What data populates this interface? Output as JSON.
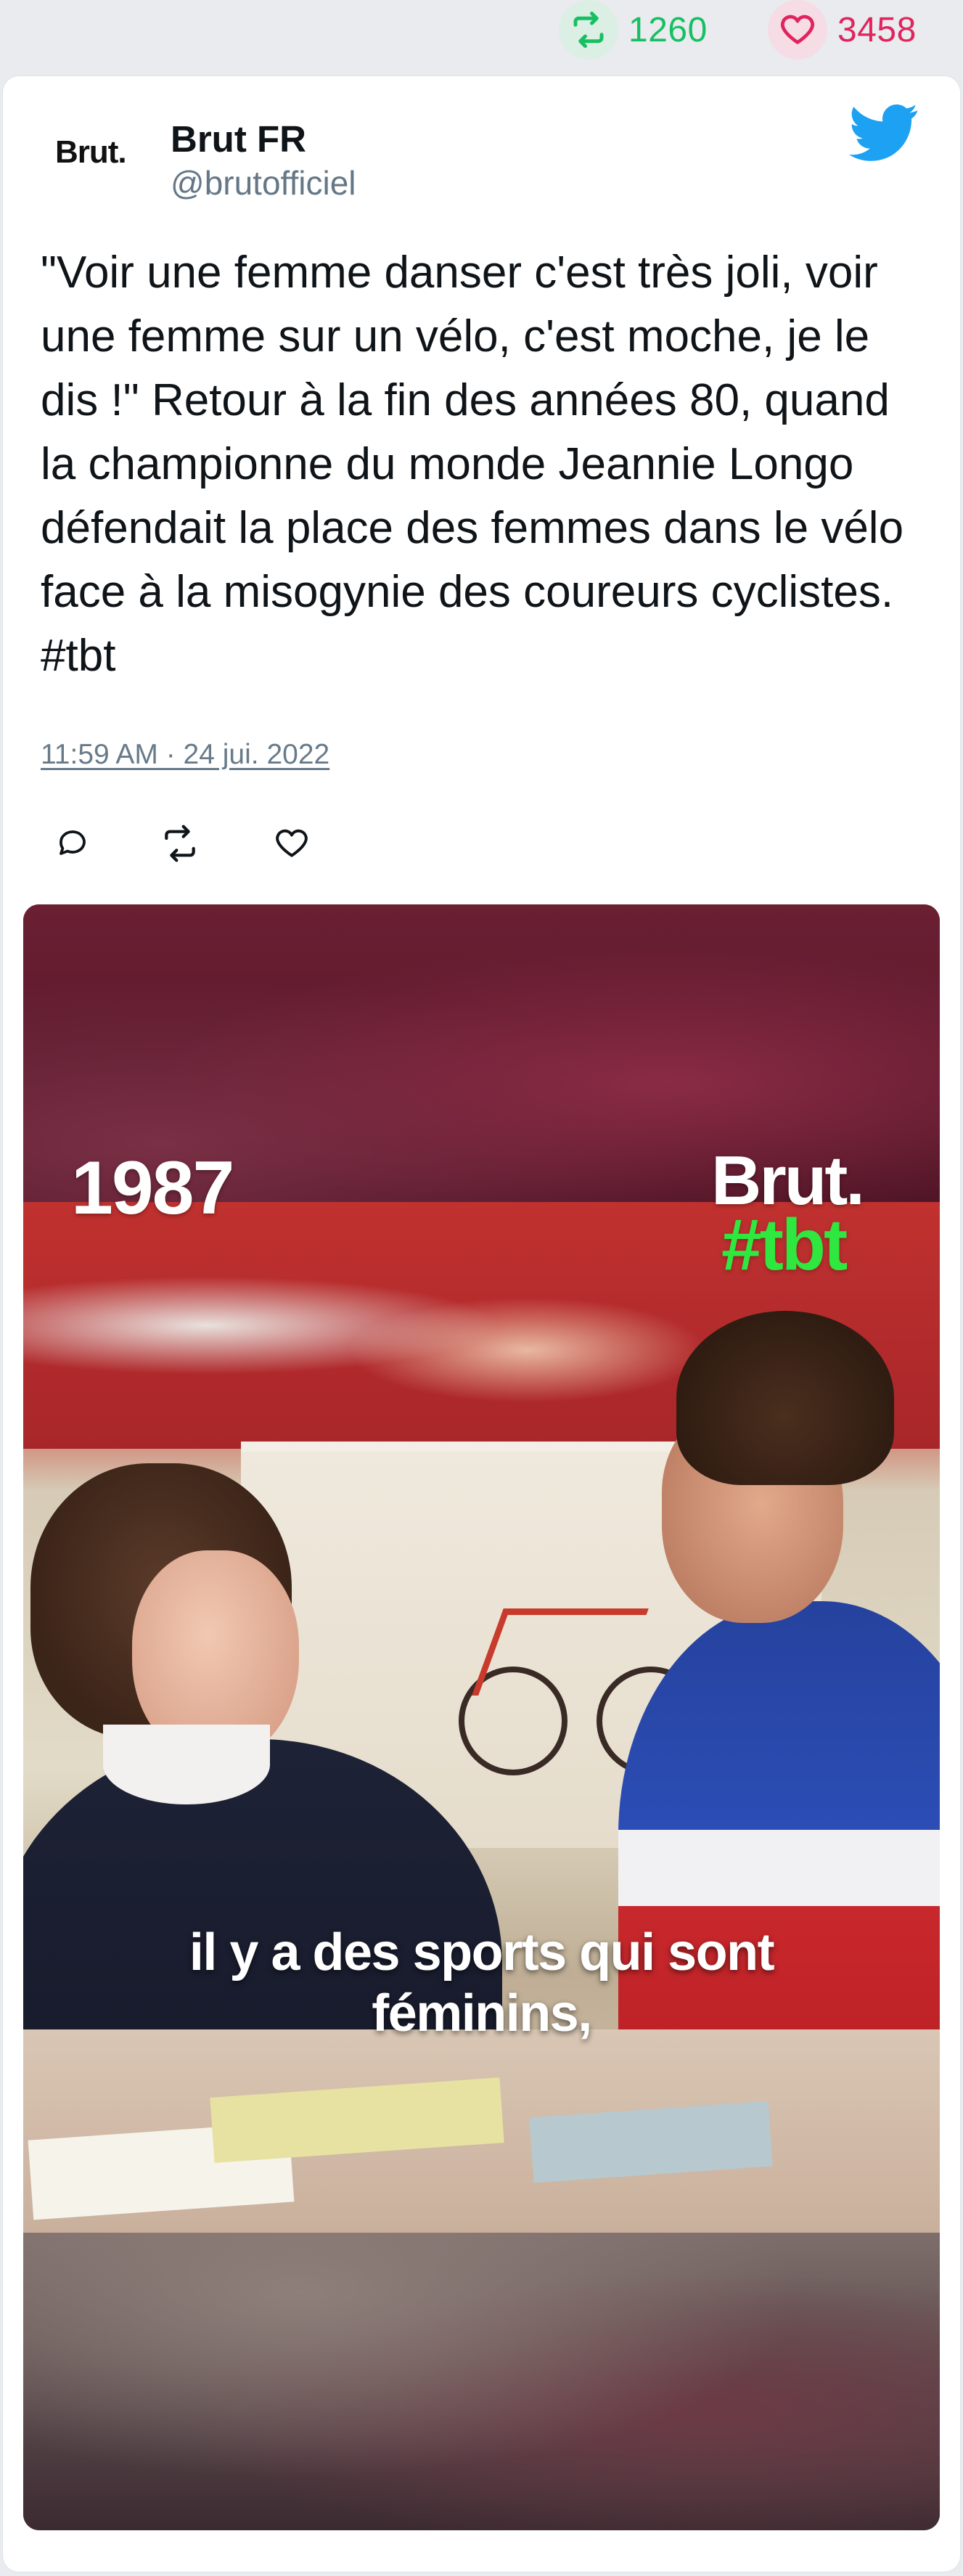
{
  "stats": {
    "retweets": "1260",
    "likes": "3458",
    "retweet_icon": "retweet-icon",
    "like_icon": "heart-icon",
    "retweet_color": "#17bf63",
    "like_color": "#e0245e"
  },
  "tweet": {
    "avatar_text": "Brut.",
    "author_name": "Brut FR",
    "author_handle": "@brutofficiel",
    "text": "\"Voir une femme danser c'est très joli, voir une femme sur un vélo, c'est moche, je le dis !\" Retour à la fin des années 80, quand la championne du monde Jeannie Longo défendait la place des femmes dans le vélo face à la misogynie des coureurs cyclistes. #tbt",
    "timestamp": "11:59 AM · 24 jui. 2022",
    "brand_icon": "twitter-bird-icon",
    "brand_color": "#1da1f2"
  },
  "actions": {
    "reply_icon": "reply-icon",
    "retweet_icon": "retweet-icon",
    "like_icon": "heart-icon"
  },
  "media": {
    "year": "1987",
    "brand": "Brut.",
    "tag": "#tbt",
    "caption_line1": "il y a des sports qui sont",
    "caption_line2": "féminins,",
    "tag_color": "#2ee83f"
  }
}
